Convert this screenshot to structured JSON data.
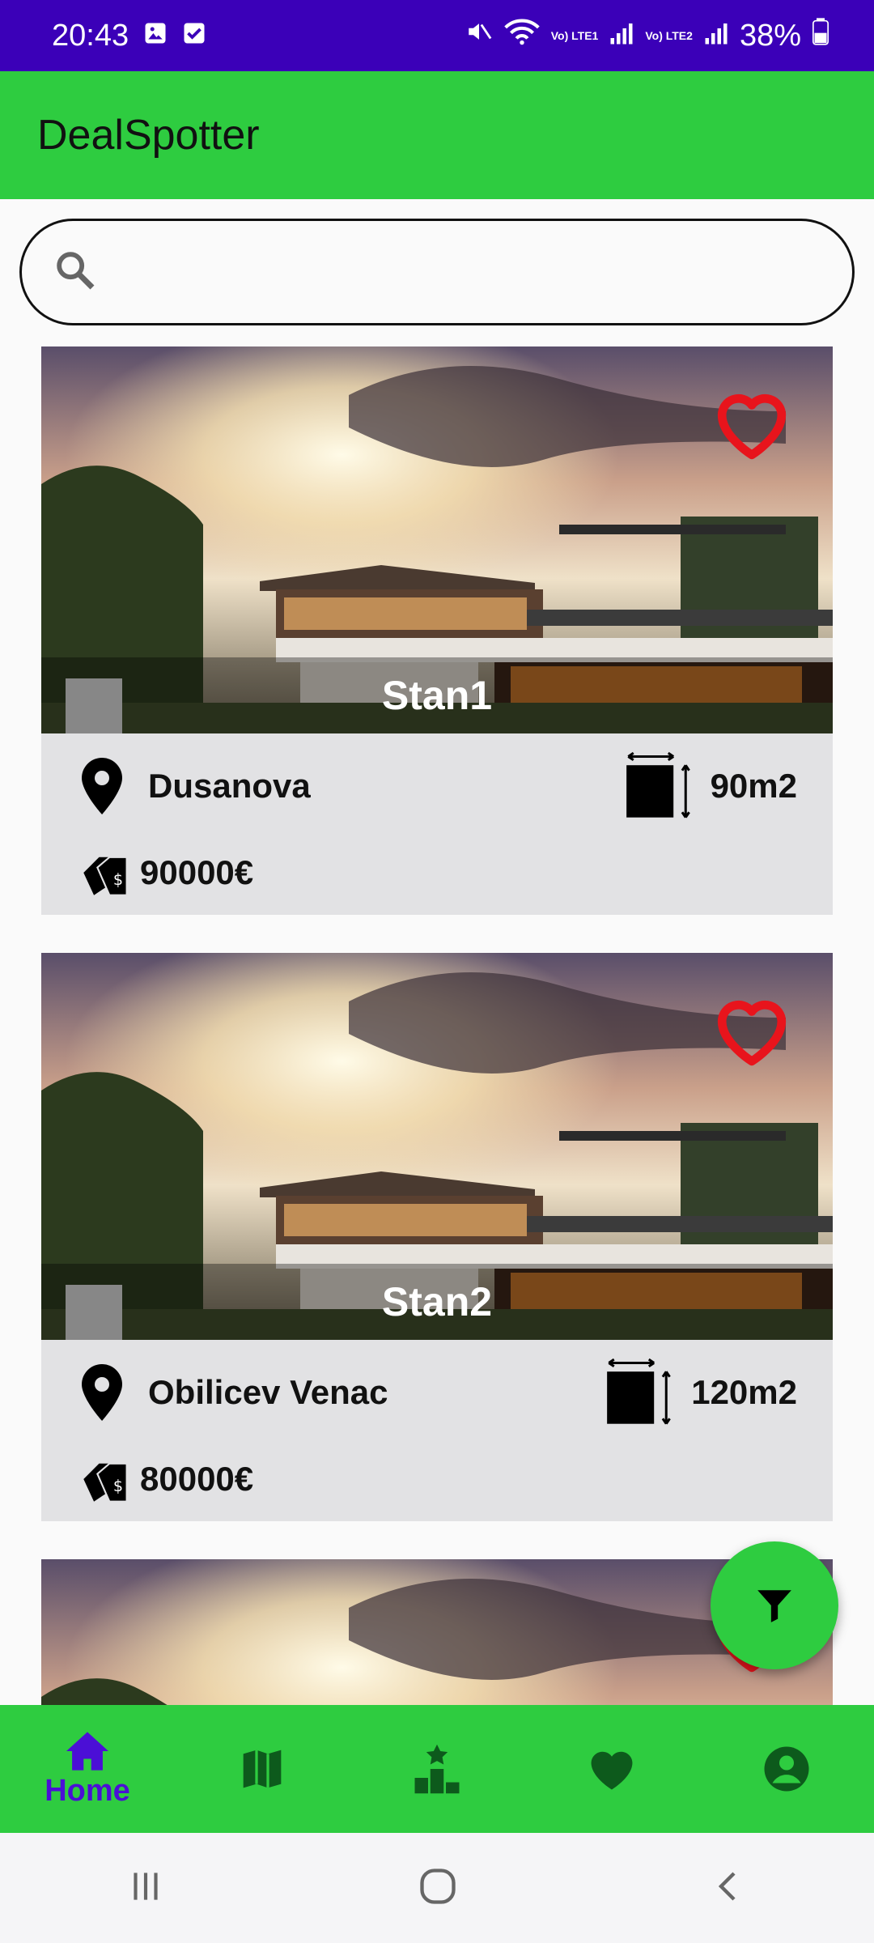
{
  "status_bar": {
    "time": "20:43",
    "battery": "38%",
    "sim1": "Vo) LTE1",
    "sim2": "Vo) LTE2"
  },
  "app": {
    "title": "DealSpotter"
  },
  "search": {
    "placeholder": "",
    "value": ""
  },
  "listings": [
    {
      "title": "Stan1",
      "location": "Dusanova",
      "area": "90m2",
      "price": "90000€",
      "favorite": true
    },
    {
      "title": "Stan2",
      "location": "Obilicev Venac",
      "area": "120m2",
      "price": "80000€",
      "favorite": true
    },
    {
      "title": "",
      "favorite": true
    }
  ],
  "bottom_nav": {
    "items": [
      {
        "label": "Home",
        "icon": "home-icon",
        "active": true
      },
      {
        "icon": "map-icon"
      },
      {
        "icon": "leaderboard-icon"
      },
      {
        "icon": "heart-icon"
      },
      {
        "icon": "account-icon"
      }
    ]
  },
  "colors": {
    "status_bar": "#3b00b8",
    "app_bar": "#2ecc40",
    "active_nav": "#4b0fd6",
    "favorite": "#e8141c"
  },
  "icons": {
    "fab": "filter-icon",
    "system_nav": [
      "recents-icon",
      "home-circle-icon",
      "back-icon"
    ]
  }
}
